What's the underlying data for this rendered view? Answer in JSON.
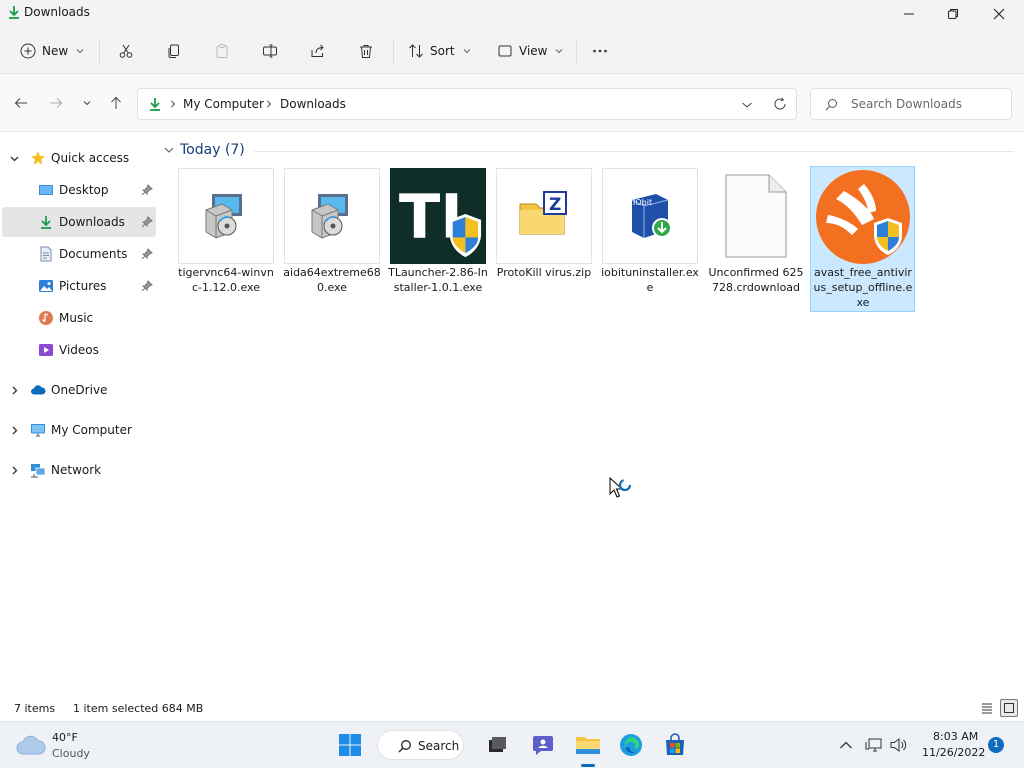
{
  "window": {
    "title": "Downloads",
    "minimize_icon": "minimize-icon",
    "maximize_icon": "restore-icon",
    "close_icon": "close-icon"
  },
  "toolbar": {
    "new_label": "New",
    "sort_label": "Sort",
    "view_label": "View",
    "icons": [
      "cut-icon",
      "copy-icon",
      "paste-icon",
      "rename-icon",
      "share-icon",
      "delete-icon",
      "more-icon"
    ]
  },
  "address": {
    "crumbs": [
      "My Computer",
      "Downloads"
    ],
    "search_placeholder": "Search Downloads"
  },
  "sidebar": {
    "items": [
      {
        "label": "Quick access"
      },
      {
        "label": "Desktop"
      },
      {
        "label": "Downloads"
      },
      {
        "label": "Documents"
      },
      {
        "label": "Pictures"
      },
      {
        "label": "Music"
      },
      {
        "label": "Videos"
      },
      {
        "label": "OneDrive"
      },
      {
        "label": "My Computer"
      },
      {
        "label": "Network"
      }
    ]
  },
  "content": {
    "group_header": "Today (7)",
    "files": [
      {
        "name": "tigervnc64-winvnc-1.12.0.exe",
        "icon": "installer-icon"
      },
      {
        "name": "aida64extreme680.exe",
        "icon": "installer-icon"
      },
      {
        "name": "TLauncher-2.86-Installer-1.0.1.exe",
        "icon": "tlauncher-icon"
      },
      {
        "name": "ProtoKill virus.zip",
        "icon": "zip-folder-icon"
      },
      {
        "name": "iobituninstaller.exe",
        "icon": "iobit-icon"
      },
      {
        "name": "Unconfirmed 625728.crdownload",
        "icon": "blank-file-icon"
      },
      {
        "name": "avast_free_antivirus_setup_offline.exe",
        "icon": "avast-icon"
      }
    ],
    "tlauncher_text": "TL",
    "iobit_text": "IObit",
    "zip_letter": "Z"
  },
  "status": {
    "items_count": "7 items",
    "selection": "1 item selected  684 MB"
  },
  "taskbar": {
    "weather_temp": "40°F",
    "weather_condition": "Cloudy",
    "search_label": "Search",
    "time": "8:03 AM",
    "date": "11/26/2022",
    "notification_count": "1"
  },
  "colors": {
    "accent": "#0f6cbd",
    "selection_fill": "#cce8ff",
    "selection_border": "#99d1ff",
    "folder_yellow": "#f4c542",
    "download_green": "#1a9e4a",
    "avast_orange": "#f37021"
  }
}
